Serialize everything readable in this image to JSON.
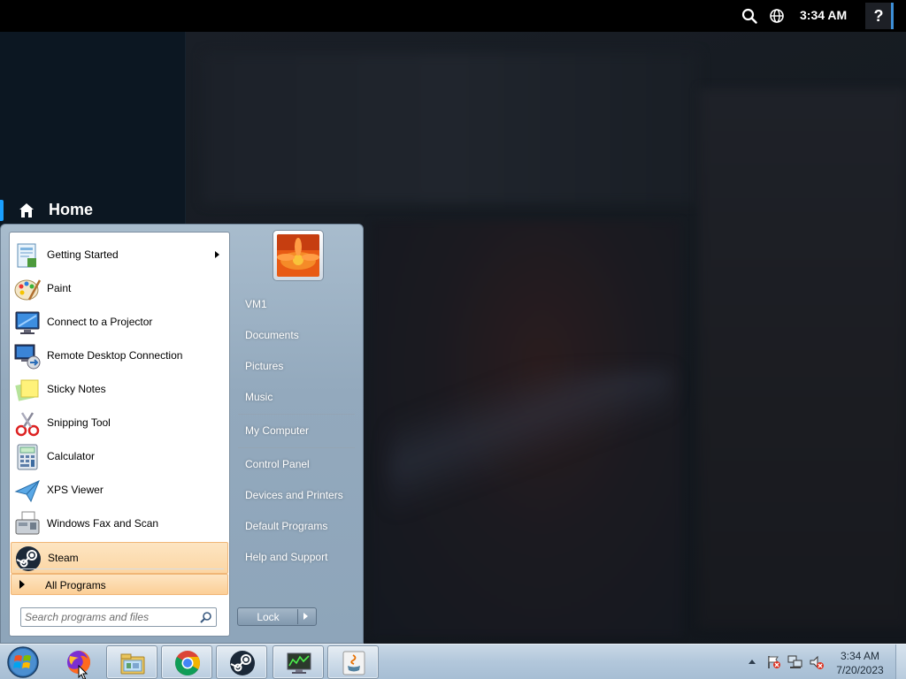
{
  "steam": {
    "time": "3:34 AM",
    "help": "?",
    "nav_home": "Home"
  },
  "start_menu": {
    "programs": [
      {
        "label": "Getting Started",
        "icon": "getting-started-icon",
        "has_submenu": true
      },
      {
        "label": "Paint",
        "icon": "paint-icon"
      },
      {
        "label": "Connect to a Projector",
        "icon": "projector-icon"
      },
      {
        "label": "Remote Desktop Connection",
        "icon": "remote-desktop-icon"
      },
      {
        "label": "Sticky Notes",
        "icon": "sticky-notes-icon"
      },
      {
        "label": "Snipping Tool",
        "icon": "snipping-tool-icon"
      },
      {
        "label": "Calculator",
        "icon": "calculator-icon"
      },
      {
        "label": "XPS Viewer",
        "icon": "xps-viewer-icon"
      },
      {
        "label": "Windows Fax and Scan",
        "icon": "fax-scan-icon"
      },
      {
        "label": "Steam",
        "icon": "steam-icon",
        "highlighted": true
      }
    ],
    "all_programs": "All Programs",
    "search_placeholder": "Search programs and files",
    "right_links": [
      "VM1",
      "Documents",
      "Pictures",
      "Music",
      "My Computer",
      "Control Panel",
      "Devices and Printers",
      "Default Programs",
      "Help and Support"
    ],
    "lock": "Lock"
  },
  "taskbar": {
    "apps": [
      "start-orb-icon",
      "firefox-icon",
      "file-explorer-icon",
      "chrome-icon",
      "steam-icon",
      "task-manager-icon",
      "java-icon"
    ],
    "clock_time": "3:34 AM",
    "clock_date": "7/20/2023"
  },
  "colors": {
    "steam_accent": "#1a9fff",
    "menu_highlight": "#fcd6a4"
  }
}
